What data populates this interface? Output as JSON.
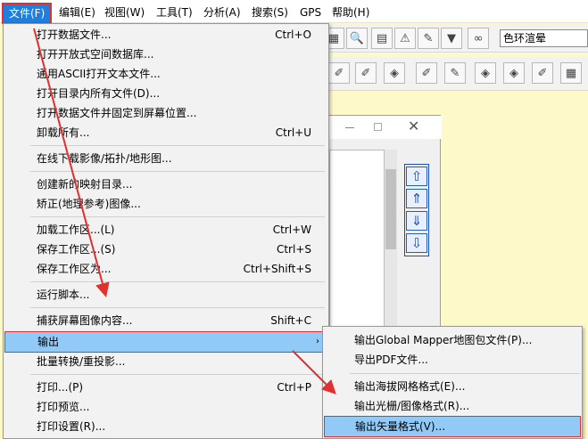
{
  "menubar": {
    "items": [
      "文件(F)",
      "编辑(E)",
      "视图(W)",
      "工具(T)",
      "分析(A)",
      "搜索(S)",
      "GPS",
      "帮助(H)"
    ]
  },
  "toolbar": {
    "combo_value": "色环渲晕"
  },
  "file_menu": {
    "items": [
      {
        "label": "打开数据文件...",
        "shortcut": "Ctrl+O"
      },
      {
        "label": "打开开放式空间数据库...",
        "shortcut": ""
      },
      {
        "label": "通用ASCII打开文本文件...",
        "shortcut": ""
      },
      {
        "label": "打开目录内所有文件(D)...",
        "shortcut": ""
      },
      {
        "label": "打开数据文件并固定到屏幕位置...",
        "shortcut": ""
      },
      {
        "label": "卸载所有...",
        "shortcut": "Ctrl+U"
      },
      {
        "label": "在线下载影像/拓扑/地形图...",
        "shortcut": ""
      },
      {
        "label": "创建新的映射目录...",
        "shortcut": ""
      },
      {
        "label": "矫正(地理参考)图像...",
        "shortcut": ""
      },
      {
        "label": "加载工作区...(L)",
        "shortcut": "Ctrl+W"
      },
      {
        "label": "保存工作区...(S)",
        "shortcut": "Ctrl+S"
      },
      {
        "label": "保存工作区为...",
        "shortcut": "Ctrl+Shift+S"
      },
      {
        "label": "运行脚本...",
        "shortcut": ""
      },
      {
        "label": "捕获屏幕图像内容...",
        "shortcut": "Shift+C"
      },
      {
        "label": "输出",
        "shortcut": ""
      },
      {
        "label": "批量转换/重投影...",
        "shortcut": ""
      },
      {
        "label": "打印...(P)",
        "shortcut": "Ctrl+P"
      },
      {
        "label": "打印预览...",
        "shortcut": ""
      },
      {
        "label": "打印设置(R)...",
        "shortcut": ""
      }
    ]
  },
  "export_submenu": {
    "items": [
      "输出Global Mapper地图包文件(P)...",
      "导出PDF文件...",
      "输出海拔网格格式(E)...",
      "输出光栅/图像格式(R)...",
      "输出矢量格式(V)..."
    ]
  },
  "colors": {
    "highlight": "#91c9f7",
    "annotation_red": "#e03030",
    "menubar_active": "#1e7fe0",
    "map_background": "#fdf9c8"
  }
}
